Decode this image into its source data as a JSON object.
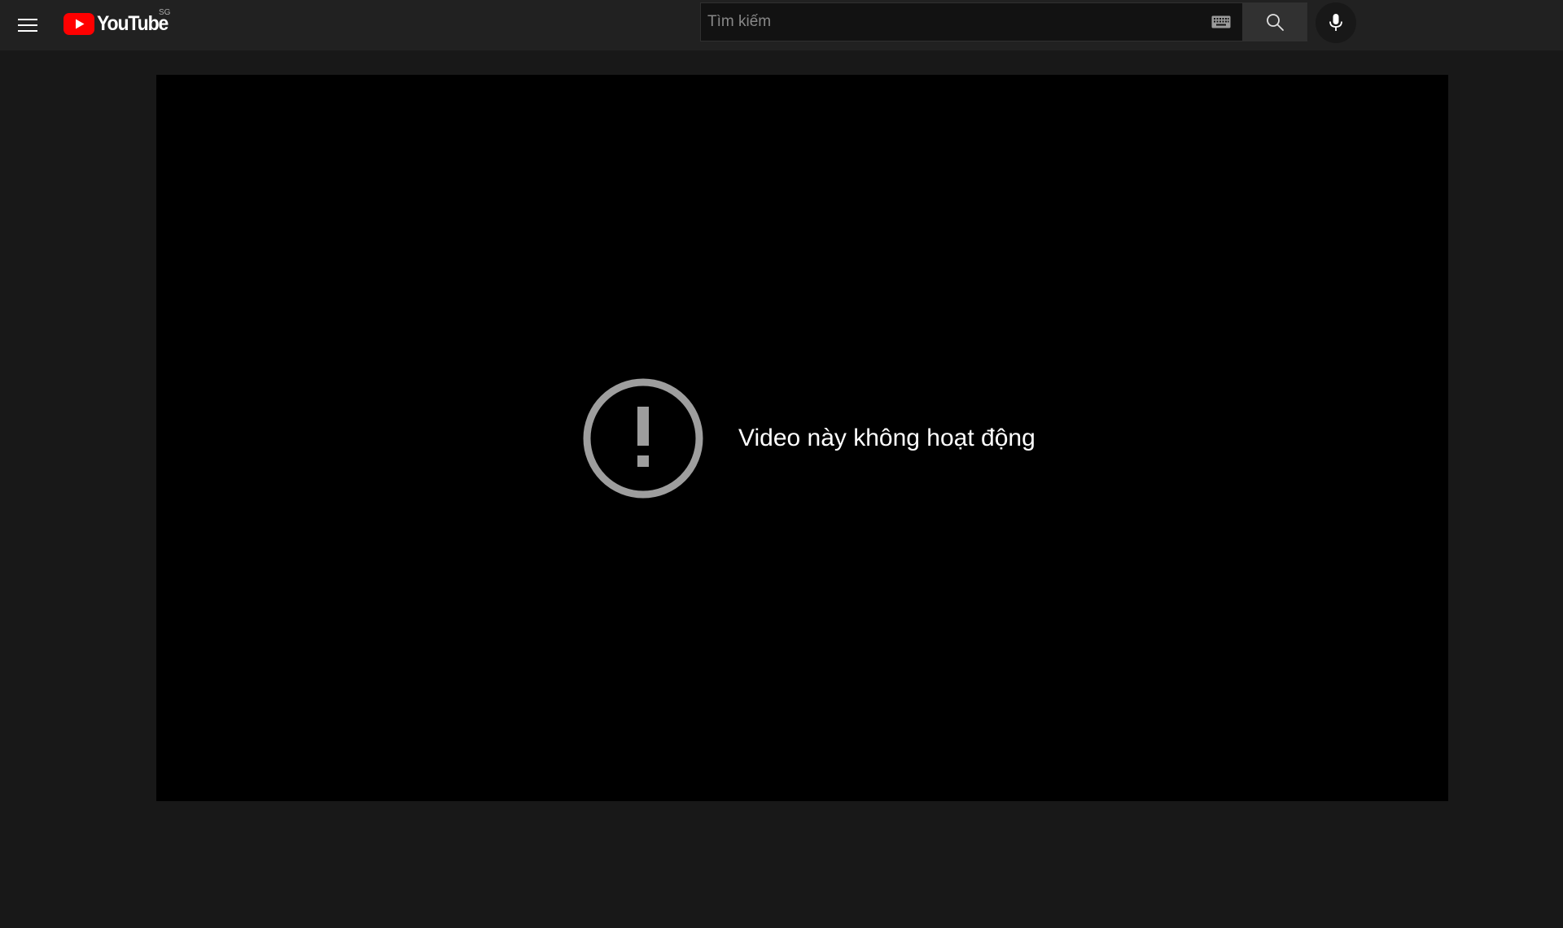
{
  "masthead": {
    "logo_text": "YouTube",
    "country_code": "SG",
    "menu_icon": "hamburger-menu-icon",
    "logo_icon": "youtube-play-icon",
    "brand_color": "#FF0000"
  },
  "search": {
    "placeholder": "Tìm kiếm",
    "value": "",
    "keyboard_icon": "keyboard-icon",
    "search_icon": "search-icon",
    "mic_icon": "microphone-icon"
  },
  "player": {
    "error_icon": "alert-circle-icon",
    "error_message": "Video này không hoạt động"
  },
  "colors": {
    "page_background": "#181818",
    "masthead_background": "#212121",
    "player_background": "#000000",
    "error_icon_color": "#9E9E9E"
  }
}
